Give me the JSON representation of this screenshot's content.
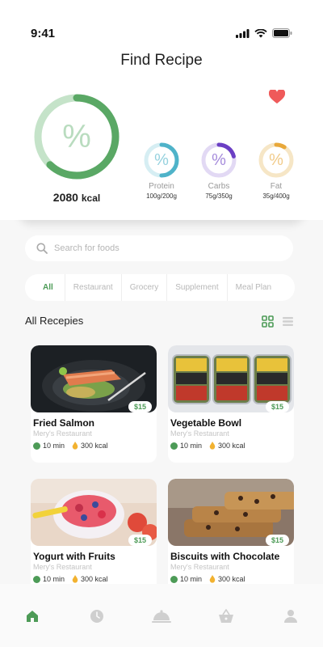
{
  "status": {
    "time": "9:41"
  },
  "header": {
    "title": "Find Recipe"
  },
  "summary": {
    "main_symbol": "%",
    "kcal_value": "2080",
    "kcal_unit": "kcal",
    "macros": [
      {
        "symbol": "%",
        "name": "Protein",
        "value": "100g/200g",
        "color": "#4fb3c9",
        "progress": 0.5
      },
      {
        "symbol": "%",
        "name": "Carbs",
        "value": "75g/350g",
        "color": "#6b3fc4",
        "progress": 0.21
      },
      {
        "symbol": "%",
        "name": "Fat",
        "value": "35g/400g",
        "color": "#e8a83a",
        "progress": 0.09
      }
    ],
    "main_progress": 0.62,
    "accent_color": "#4d9b57"
  },
  "search": {
    "placeholder": "Search for foods",
    "value": ""
  },
  "filters": [
    "All",
    "Restaurant",
    "Grocery",
    "Supplement",
    "Meal Plan"
  ],
  "active_filter": "All",
  "recipes_section": {
    "title": "All Recepies"
  },
  "recipes": [
    {
      "name": "Fried Salmon",
      "restaurant": "Mery's Restaurant",
      "time": "10 min",
      "kcal": "300 kcal",
      "price": "$15"
    },
    {
      "name": "Vegetable Bowl",
      "restaurant": "Mery's Restaurant",
      "time": "10 min",
      "kcal": "300 kcal",
      "price": "$15"
    },
    {
      "name": "Yogurt with Fruits",
      "restaurant": "Mery's Restaurant",
      "time": "10 min",
      "kcal": "300 kcal",
      "price": "$15"
    },
    {
      "name": "Biscuits with Chocolate",
      "restaurant": "Mery's Restaurant",
      "time": "10 min",
      "kcal": "300 kcal",
      "price": "$15"
    }
  ],
  "nav": [
    "home-icon",
    "clock-icon",
    "cloche-icon",
    "basket-icon",
    "profile-icon"
  ]
}
